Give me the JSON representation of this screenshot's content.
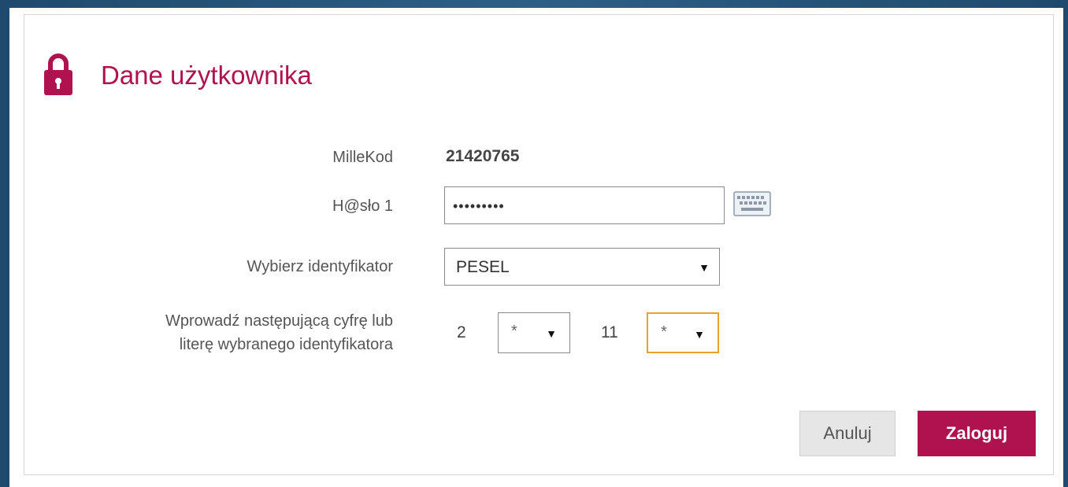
{
  "header": {
    "title": "Dane użytkownika",
    "icon": "lock-icon",
    "accent": "#b0124f"
  },
  "form": {
    "millekod": {
      "label": "MilleKod",
      "value": "21420765"
    },
    "password": {
      "label": "H@sło 1",
      "value": "•••••••••",
      "keyboard_icon": "keyboard-icon"
    },
    "identifier": {
      "label": "Wybierz identyfikator",
      "selected": "PESEL"
    },
    "digits": {
      "label_line1": "Wprowadź następującą cyfrę lub",
      "label_line2": "literę wybranego identyfikatora",
      "first_position": "2",
      "first_value": "*",
      "second_position": "11",
      "second_value": "*"
    }
  },
  "buttons": {
    "cancel": "Anuluj",
    "login": "Zaloguj"
  },
  "arrow_glyph": "▼"
}
